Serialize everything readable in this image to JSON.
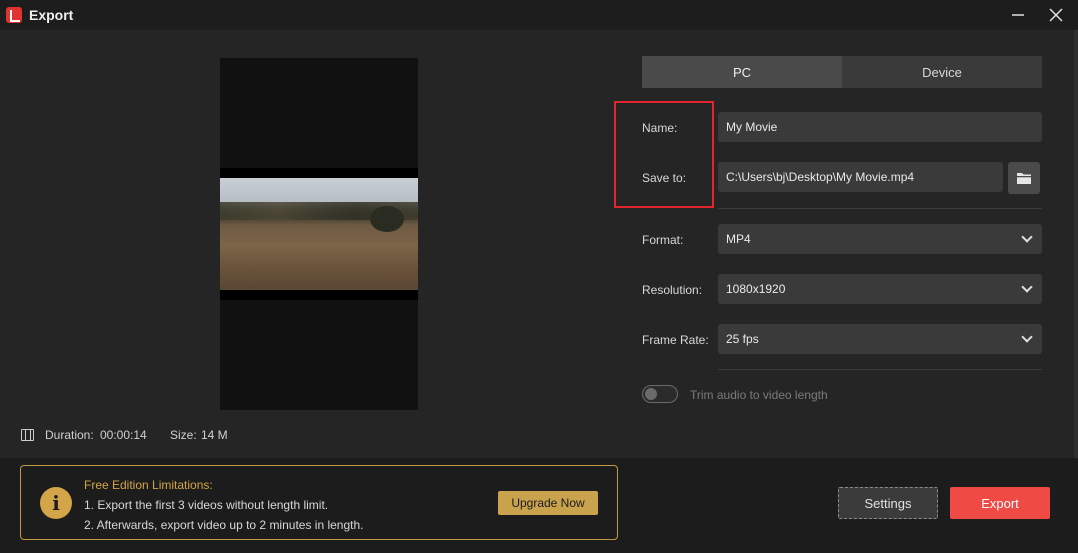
{
  "window": {
    "title": "Export"
  },
  "preview": {
    "duration_label": "Duration:",
    "duration_value": "00:00:14",
    "size_label": "Size:",
    "size_value": "14 M"
  },
  "tabs": [
    {
      "label": "PC",
      "active": true
    },
    {
      "label": "Device",
      "active": false
    }
  ],
  "form": {
    "name_label": "Name:",
    "name_value": "My Movie",
    "save_label": "Save to:",
    "save_value": "C:\\Users\\bj\\Desktop\\My Movie.mp4",
    "format_label": "Format:",
    "format_value": "MP4",
    "resolution_label": "Resolution:",
    "resolution_value": "1080x1920",
    "framerate_label": "Frame Rate:",
    "framerate_value": "25 fps",
    "trim_label": "Trim audio to video length",
    "trim_enabled": false
  },
  "limitations": {
    "title": "Free Edition Limitations:",
    "line1": "1. Export the first 3 videos without length limit.",
    "line2": "2. Afterwards, export video up to 2 minutes in length.",
    "upgrade_label": "Upgrade Now"
  },
  "actions": {
    "settings_label": "Settings",
    "export_label": "Export"
  },
  "colors": {
    "accent_export": "#f04a45",
    "highlight_box": "#e3262e",
    "limit_gold": "#d3a548"
  },
  "icons": {
    "app": "app-logo-icon",
    "minimize": "minimize-icon",
    "close": "close-icon",
    "film": "film-icon",
    "folder": "folder-icon",
    "info": "info-icon",
    "chevron": "chevron-down-icon"
  }
}
